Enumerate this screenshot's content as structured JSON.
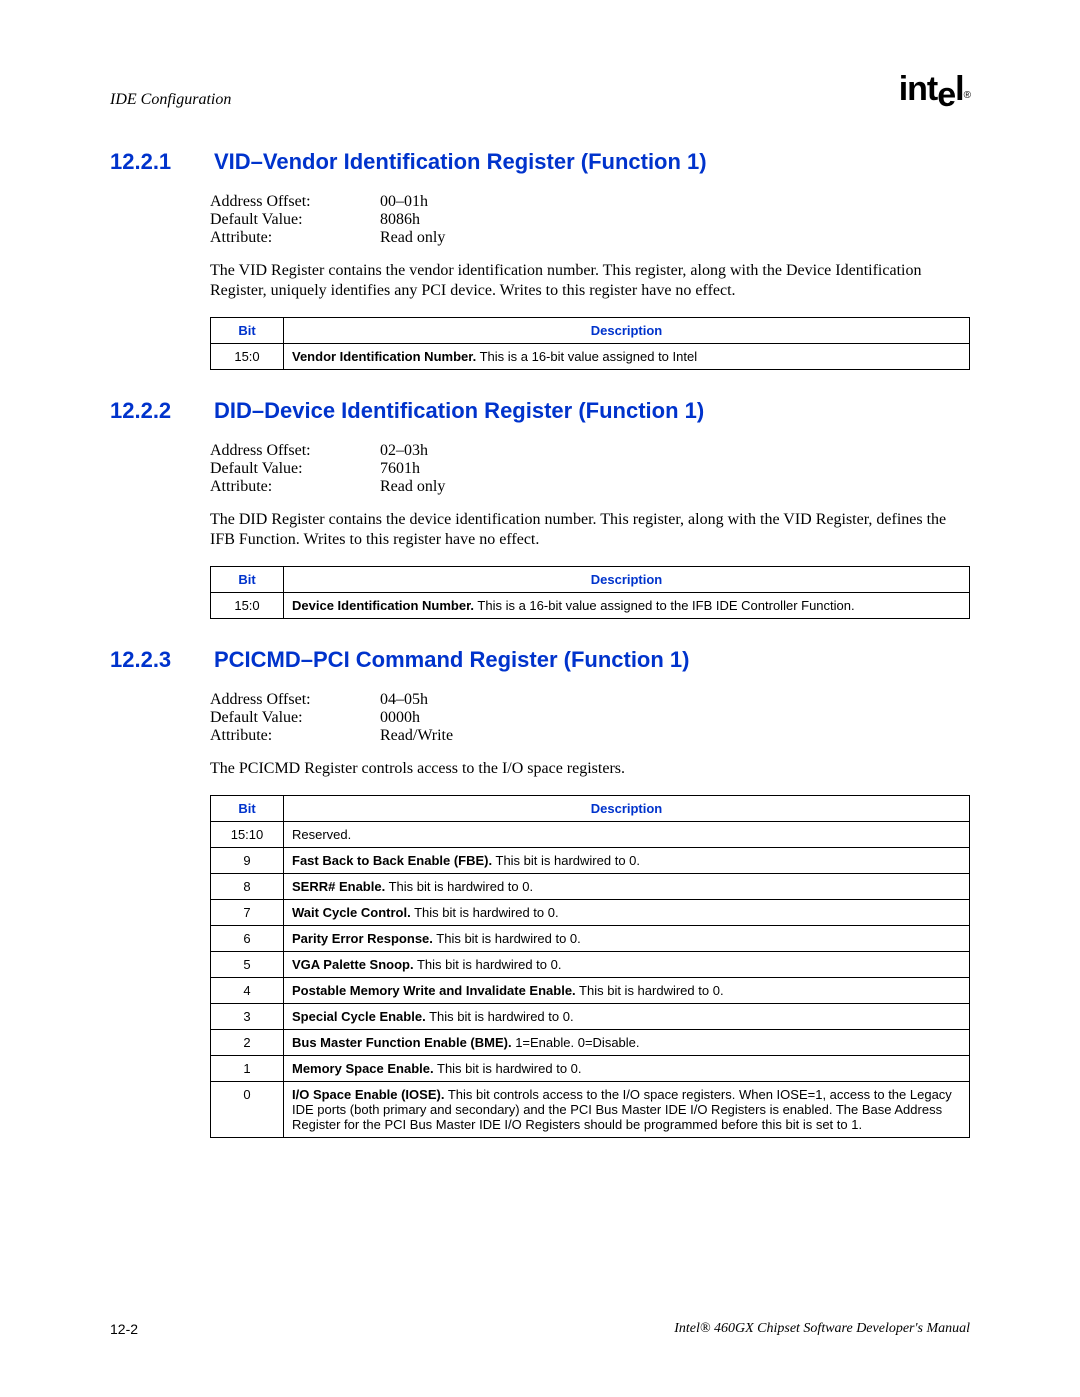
{
  "header": {
    "title": "IDE Configuration",
    "logo": "intel",
    "logo_sub": "®"
  },
  "sections": [
    {
      "num": "12.2.1",
      "title": "VID–Vendor Identification Register (Function 1)",
      "kv": [
        {
          "k": "Address Offset:",
          "v": "00–01h"
        },
        {
          "k": "Default Value:",
          "v": "8086h"
        },
        {
          "k": "Attribute:",
          "v": "Read only"
        }
      ],
      "para": "The VID Register contains the vendor identification number. This register, along with the Device Identification Register, uniquely identifies any PCI device. Writes to this register have no effect.",
      "table_header": {
        "bit": "Bit",
        "desc": "Description"
      },
      "rows": [
        {
          "bit": "15:0",
          "bold": "Vendor Identification Number.",
          "rest": " This is a 16-bit value assigned to Intel"
        }
      ]
    },
    {
      "num": "12.2.2",
      "title": "DID–Device Identification Register (Function 1)",
      "kv": [
        {
          "k": "Address Offset:",
          "v": "02–03h"
        },
        {
          "k": "Default Value:",
          "v": "7601h"
        },
        {
          "k": "Attribute:",
          "v": "Read only"
        }
      ],
      "para": "The DID Register contains the device identification number. This register, along with the VID Register, defines the IFB Function. Writes to this register have no effect.",
      "table_header": {
        "bit": "Bit",
        "desc": "Description"
      },
      "rows": [
        {
          "bit": "15:0",
          "bold": "Device Identification Number.",
          "rest": " This is a 16-bit value assigned to the IFB IDE Controller Function."
        }
      ]
    },
    {
      "num": "12.2.3",
      "title": "PCICMD–PCI Command Register (Function 1)",
      "kv": [
        {
          "k": "Address Offset:",
          "v": "04–05h"
        },
        {
          "k": "Default Value:",
          "v": "0000h"
        },
        {
          "k": "Attribute:",
          "v": "Read/Write"
        }
      ],
      "para": "The PCICMD Register controls access to the I/O space registers.",
      "table_header": {
        "bit": "Bit",
        "desc": "Description"
      },
      "rows": [
        {
          "bit": "15:10",
          "bold": "",
          "rest": "Reserved."
        },
        {
          "bit": "9",
          "bold": "Fast Back to Back Enable (FBE).",
          "rest": " This bit is hardwired to 0."
        },
        {
          "bit": "8",
          "bold": "SERR# Enable.",
          "rest": " This bit is hardwired to 0."
        },
        {
          "bit": "7",
          "bold": "Wait Cycle Control.",
          "rest": " This bit is hardwired to 0."
        },
        {
          "bit": "6",
          "bold": "Parity Error Response.",
          "rest": " This bit is hardwired to 0."
        },
        {
          "bit": "5",
          "bold": "VGA Palette Snoop.",
          "rest": " This bit is hardwired to 0."
        },
        {
          "bit": "4",
          "bold": "Postable Memory Write and Invalidate Enable.",
          "rest": " This bit is hardwired to 0."
        },
        {
          "bit": "3",
          "bold": "Special Cycle Enable.",
          "rest": " This bit is hardwired to 0."
        },
        {
          "bit": "2",
          "bold": "Bus Master Function Enable (BME).",
          "rest": " 1=Enable. 0=Disable."
        },
        {
          "bit": "1",
          "bold": "Memory Space Enable.",
          "rest": " This bit is hardwired to 0."
        },
        {
          "bit": "0",
          "bold": "I/O Space Enable (IOSE).",
          "rest": " This bit controls access to the I/O space registers. When IOSE=1, access to the Legacy IDE ports (both primary and secondary) and the PCI Bus Master IDE I/O Registers is enabled. The Base Address Register for the PCI Bus Master IDE I/O Registers should be programmed before this bit is set to 1."
        }
      ]
    }
  ],
  "footer": {
    "page": "12-2",
    "manual": "Intel® 460GX Chipset Software Developer's Manual"
  }
}
